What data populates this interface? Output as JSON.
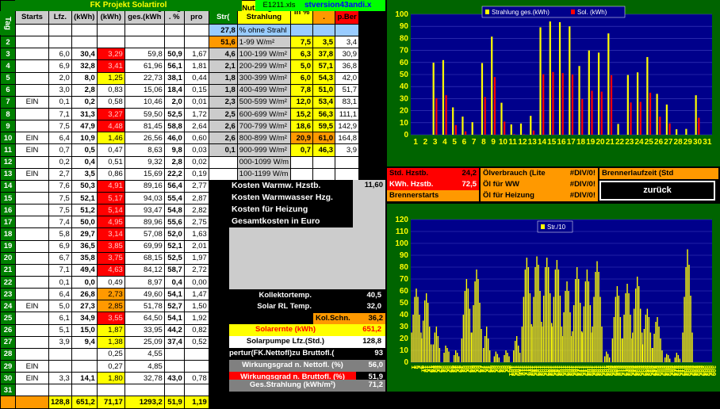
{
  "header": {
    "title": "FK Projekt Solartirol",
    "filename": "E1211.xls",
    "version": "stversion43andi.x",
    "tab": "Tag",
    "cols": [
      "Ofen Starts",
      "Sol.P Lfz.",
      "Sol. (kWh)",
      "Str/m² (kWh)",
      "Strahlung ges.(kWh",
      "Nzg . %",
      "kWh pro",
      "Ges Str(",
      "Nutzung der Strahlung",
      "in %",
      "Nutz .",
      "kWh p.Ber"
    ]
  },
  "rows": [
    {
      "i": "1",
      "o": "",
      "l": "",
      "s": "",
      "sm": "",
      "sg": "",
      "n": "",
      "k": "",
      "gs": "27,8",
      "nu": "% ohne Strahl",
      "ip": "",
      "nz": "",
      "kb": ""
    },
    {
      "i": "2",
      "o": "",
      "l": "",
      "s": "",
      "sm": "",
      "sg": "",
      "n": "",
      "k": "",
      "gs": "51,6",
      "nu": "1-99 W/m²",
      "ip": "7,5",
      "nz": "3,5",
      "kb": "3,4"
    },
    {
      "i": "3",
      "o": "",
      "l": "6,0",
      "s": "30,4",
      "sm": "3,29",
      "sg": "59,8",
      "n": "50,9",
      "k": "1,67",
      "gs": "4,6",
      "nu": "100-199 W/m²",
      "ip": "6,3",
      "nz": "37,8",
      "kb": "30,9"
    },
    {
      "i": "4",
      "o": "",
      "l": "6,9",
      "s": "32,8",
      "sm": "3,41",
      "sg": "61,96",
      "n": "56,1",
      "k": "1,81",
      "gs": "2,1",
      "nu": "200-299 W/m²",
      "ip": "5,0",
      "nz": "57,1",
      "kb": "36,8"
    },
    {
      "i": "5",
      "o": "",
      "l": "2,0",
      "s": "8,0",
      "sm": "1,25",
      "sg": "22,73",
      "n": "38,1",
      "k": "0,44",
      "gs": "1,8",
      "nu": "300-399 W/m²",
      "ip": "6,0",
      "nz": "54,3",
      "kb": "42,0"
    },
    {
      "i": "6",
      "o": "",
      "l": "3,0",
      "s": "2,8",
      "sm": "0,83",
      "sg": "15,06",
      "n": "18,4",
      "k": "0,15",
      "gs": "1,8",
      "nu": "400-499 W/m²",
      "ip": "7,8",
      "nz": "51,0",
      "kb": "51,7"
    },
    {
      "i": "7",
      "o": "EIN",
      "l": "0,1",
      "s": "0,2",
      "sm": "0,58",
      "sg": "10,46",
      "n": "2,0",
      "k": "0,01",
      "gs": "2,3",
      "nu": "500-599 W/m²",
      "ip": "12,0",
      "nz": "53,4",
      "kb": "83,1"
    },
    {
      "i": "8",
      "o": "",
      "l": "7,1",
      "s": "31,3",
      "sm": "3,27",
      "sg": "59,50",
      "n": "52,5",
      "k": "1,72",
      "gs": "2,5",
      "nu": "600-699 W/m²",
      "ip": "15,2",
      "nz": "56,3",
      "kb": "111,1"
    },
    {
      "i": "9",
      "o": "",
      "l": "7,5",
      "s": "47,9",
      "sm": "4,48",
      "sg": "81,45",
      "n": "58,8",
      "k": "2,64",
      "gs": "2,6",
      "nu": "700-799 W/m²",
      "ip": "18,6",
      "nz": "59,5",
      "kb": "142,9"
    },
    {
      "i": "10",
      "o": "EIN",
      "l": "6,4",
      "s": "10,9",
      "sm": "1,46",
      "sg": "26,56",
      "n": "46,0",
      "k": "0,60",
      "gs": "2,6",
      "nu": "800-899 W/m²",
      "ip": "20,9",
      "nz": "61,0",
      "kb": "164,8"
    },
    {
      "i": "11",
      "o": "EIN",
      "l": "0,7",
      "s": "0,5",
      "sm": "0,47",
      "sg": "8,63",
      "n": "9,8",
      "k": "0,03",
      "gs": "0,1",
      "nu": "900-999 W/m²",
      "ip": "0,7",
      "nz": "46,3",
      "kb": "3,9"
    },
    {
      "i": "12",
      "o": "",
      "l": "0,2",
      "s": "0,4",
      "sm": "0,51",
      "sg": "9,32",
      "n": "2,8",
      "k": "0,02",
      "gs": "",
      "nu": "000-1099 W/m",
      "ip": "",
      "nz": "",
      "kb": ""
    },
    {
      "i": "13",
      "o": "EIN",
      "l": "2,7",
      "s": "3,5",
      "sm": "0,86",
      "sg": "15,69",
      "n": "22,2",
      "k": "0,19",
      "gs": "",
      "nu": "100-1199 W/m",
      "ip": "",
      "nz": "",
      "kb": ""
    },
    {
      "i": "14",
      "o": "",
      "l": "7,6",
      "s": "50,3",
      "sm": "4,91",
      "sg": "89,16",
      "n": "56,4",
      "k": "2,77",
      "gs": "",
      "nu": "",
      "ip": "",
      "nz": "",
      "kb": ""
    },
    {
      "i": "15",
      "o": "",
      "l": "7,5",
      "s": "52,1",
      "sm": "5,17",
      "sg": "94,03",
      "n": "55,4",
      "k": "2,87",
      "gs": "",
      "nu": "",
      "ip": "",
      "nz": "",
      "kb": ""
    },
    {
      "i": "16",
      "o": "",
      "l": "7,5",
      "s": "51,2",
      "sm": "5,14",
      "sg": "93,47",
      "n": "54,8",
      "k": "2,82",
      "gs": "",
      "nu": "",
      "ip": "",
      "nz": "",
      "kb": ""
    },
    {
      "i": "17",
      "o": "",
      "l": "7,4",
      "s": "50,0",
      "sm": "4,95",
      "sg": "89,96",
      "n": "55,6",
      "k": "2,75",
      "gs": "",
      "nu": "",
      "ip": "",
      "nz": "",
      "kb": ""
    },
    {
      "i": "18",
      "o": "",
      "l": "5,8",
      "s": "29,7",
      "sm": "3,14",
      "sg": "57,08",
      "n": "52,0",
      "k": "1,63",
      "gs": "",
      "nu": "",
      "ip": "",
      "nz": "",
      "kb": ""
    },
    {
      "i": "19",
      "o": "",
      "l": "6,9",
      "s": "36,5",
      "sm": "3,85",
      "sg": "69,99",
      "n": "52,1",
      "k": "2,01",
      "gs": "",
      "nu": "",
      "ip": "",
      "nz": "",
      "kb": ""
    },
    {
      "i": "20",
      "o": "",
      "l": "6,7",
      "s": "35,8",
      "sm": "3,75",
      "sg": "68,15",
      "n": "52,5",
      "k": "1,97",
      "gs": "",
      "nu": "",
      "ip": "",
      "nz": "",
      "kb": ""
    },
    {
      "i": "21",
      "o": "",
      "l": "7,1",
      "s": "49,4",
      "sm": "4,63",
      "sg": "84,12",
      "n": "58,7",
      "k": "2,72",
      "gs": "",
      "nu": "",
      "ip": "",
      "nz": "",
      "kb": ""
    },
    {
      "i": "22",
      "o": "",
      "l": "0,1",
      "s": "0,0",
      "sm": "0,49",
      "sg": "8,97",
      "n": "0,4",
      "k": "0,00",
      "gs": "",
      "nu": "",
      "ip": "",
      "nz": "",
      "kb": ""
    },
    {
      "i": "23",
      "o": "",
      "l": "6,4",
      "s": "26,8",
      "sm": "2,73",
      "sg": "49,60",
      "n": "54,1",
      "k": "1,47",
      "gs": "",
      "nu": "",
      "ip": "",
      "nz": "",
      "kb": ""
    },
    {
      "i": "24",
      "o": "EIN",
      "l": "5,0",
      "s": "27,3",
      "sm": "2,85",
      "sg": "51,78",
      "n": "52,7",
      "k": "1,50",
      "gs": "",
      "nu": "",
      "ip": "",
      "nz": "",
      "kb": ""
    },
    {
      "i": "25",
      "o": "",
      "l": "6,1",
      "s": "34,9",
      "sm": "3,55",
      "sg": "64,50",
      "n": "54,1",
      "k": "1,92",
      "gs": "",
      "nu": "",
      "ip": "",
      "nz": "",
      "kb": ""
    },
    {
      "i": "26",
      "o": "",
      "l": "5,1",
      "s": "15,0",
      "sm": "1,87",
      "sg": "33,95",
      "n": "44,2",
      "k": "0,82",
      "gs": "",
      "nu": "",
      "ip": "",
      "nz": "",
      "kb": ""
    },
    {
      "i": "27",
      "o": "",
      "l": "3,9",
      "s": "9,4",
      "sm": "1,38",
      "sg": "25,09",
      "n": "37,4",
      "k": "0,52",
      "gs": "",
      "nu": "",
      "ip": "",
      "nz": "",
      "kb": ""
    },
    {
      "i": "28",
      "o": "",
      "l": "",
      "s": "",
      "sm": "0,25",
      "sg": "4,55",
      "n": "",
      "k": "",
      "gs": "",
      "nu": "",
      "ip": "",
      "nz": "",
      "kb": ""
    },
    {
      "i": "29",
      "o": "EIN",
      "l": "",
      "s": "",
      "sm": "0,27",
      "sg": "4,85",
      "n": "",
      "k": "",
      "gs": "",
      "nu": "",
      "ip": "",
      "nz": "",
      "kb": ""
    },
    {
      "i": "30",
      "o": "EIN",
      "l": "3,3",
      "s": "14,1",
      "sm": "1,80",
      "sg": "32,78",
      "n": "43,0",
      "k": "0,78",
      "gs": "",
      "nu": "",
      "ip": "",
      "nz": "",
      "kb": ""
    },
    {
      "i": "31",
      "o": "",
      "l": "",
      "s": "",
      "sm": "",
      "sg": "",
      "n": "",
      "k": "",
      "gs": "",
      "nu": "",
      "ip": "",
      "nz": "",
      "kb": ""
    }
  ],
  "totals": {
    "l": "128,8",
    "s": "651,2",
    "sm": "71,17",
    "sg": "1293,2",
    "n": "51,9",
    "k": "1,19"
  },
  "costs": {
    "warmw_hzstb": "Kosten Warmw. Hzstb.",
    "warmw_hzstb_val": "11,60",
    "warmwasser": "Kosten Warmwasser Hzg.",
    "heizung": "Kosten für Heizung",
    "gesamt": "Gesamtkosten in Euro"
  },
  "stats": {
    "kollektortemp": "Kollektortemp.",
    "kollektortemp_val": "40,5",
    "solar_rl": "Solar RL Temp.",
    "solar_rl_val": "32,0",
    "kol_schn": "Kol.Schn.",
    "kol_schn_val": "36,2",
    "solarernte": "Solarernte (kWh)",
    "solarernte_val": "651,2",
    "solarpumpe": "Solarpumpe Lfz.(Std.)",
    "solarpumpe_val": "128,8",
    "apertur": "pertur(FK.Nettofl)zu Bruttofl.(",
    "apertur_val": "93",
    "wirk_netto": "Wirkungsgrad n. Nettofl. (%)",
    "wirk_netto_val": "56,0",
    "wirk_brutto": "Wirkungsgrad n. Bruttofl. (%)",
    "wirk_brutto_val": "51,9",
    "ges_strahlung": "Ges.Strahlung (kWh/m²)",
    "ges_strahlung_val": "71,2"
  },
  "side": {
    "std_hzstb": "Std. Hzstb.",
    "std_hzstb_val": "24,2",
    "kwh_hzstb": "KWh. Hzstb.",
    "kwh_hzstb_val": "72,5",
    "brennerstarts": "Brennerstarts",
    "oelverbrauch": "Ölverbrauch (Lite",
    "oelverbrauch_val": "#DIV/0!",
    "oel_ww": "Öl für WW",
    "oel_ww_val": "#DIV/0!",
    "oel_heizung": "Öl für Heizung",
    "oel_heizung_val": "#DIV/0!",
    "brennerlaufzeit": "Brennerlaufzeit (Std",
    "back_button": "zurück"
  },
  "colors": {
    "green": "#008000",
    "yellow": "#ffff00",
    "red": "#ff0000",
    "orange": "#ff9900",
    "cyan": "#99ccff",
    "chart_bg": "#00008b",
    "chart_frame": "#006400"
  },
  "chart_data": [
    {
      "type": "bar",
      "legend": [
        "Strahlung ges.(kWh)",
        "Sol.  (kWh)"
      ],
      "legend_position": "top",
      "categories": [
        "1",
        "2",
        "3",
        "4",
        "5",
        "6",
        "7",
        "8",
        "9",
        "10",
        "11",
        "12",
        "13",
        "14",
        "15",
        "16",
        "17",
        "18",
        "19",
        "20",
        "21",
        "22",
        "23",
        "24",
        "25",
        "26",
        "27",
        "28",
        "29",
        "30",
        "31"
      ],
      "series": [
        {
          "name": "Strahlung ges.(kWh)",
          "color": "#ffff00",
          "values": [
            0,
            0,
            59.8,
            61.96,
            22.73,
            15.06,
            10.46,
            59.5,
            81.45,
            26.56,
            8.63,
            9.32,
            15.69,
            89.16,
            94.03,
            93.47,
            89.96,
            57.08,
            69.99,
            68.15,
            84.12,
            8.97,
            49.6,
            51.78,
            64.5,
            33.95,
            25.09,
            4.55,
            4.85,
            32.78,
            0
          ]
        },
        {
          "name": "Sol.  (kWh)",
          "color": "#ff0000",
          "values": [
            0,
            0,
            30.4,
            32.8,
            8.0,
            2.8,
            0.2,
            31.3,
            47.9,
            10.9,
            0.5,
            0.4,
            3.5,
            50.3,
            52.1,
            51.2,
            50.0,
            29.7,
            36.5,
            35.8,
            49.4,
            0.0,
            26.8,
            27.3,
            34.9,
            15.0,
            9.4,
            0,
            0,
            14.1,
            0
          ]
        }
      ],
      "ylim": [
        0,
        100
      ],
      "yticks": [
        0,
        10,
        20,
        30,
        40,
        50,
        60,
        70,
        80,
        90,
        100
      ],
      "grid": true
    },
    {
      "type": "bar",
      "legend": [
        "Str./10"
      ],
      "legend_position": "top",
      "xticks": [
        "1",
        "3",
        "5",
        "7",
        "9",
        "11",
        "13",
        "15",
        "17",
        "19",
        "21",
        "23",
        "25",
        "27",
        "29",
        "31",
        "33",
        "35",
        "37",
        "39",
        "41",
        "43",
        "45",
        "47",
        "49",
        "51",
        "53",
        "55",
        "57",
        "59",
        "61",
        "63",
        "65",
        "67",
        "69",
        "71",
        "73",
        "75",
        "77",
        "79",
        "81",
        "83",
        "85",
        "87",
        "89",
        "91",
        "93",
        "95",
        "97",
        "99",
        "101",
        "103",
        "105",
        "107",
        "109",
        "111",
        "113",
        "115",
        "117",
        "119",
        "121",
        "123",
        "125",
        "127",
        "129",
        "131",
        "133",
        "135",
        "137",
        "139",
        "141",
        "143",
        "145",
        "147",
        "149",
        "151",
        "153",
        "155",
        "157",
        "159",
        "161",
        "163",
        "165",
        "167",
        "169",
        "171",
        "173",
        "175",
        "177",
        "179",
        "181",
        "183",
        "185",
        "187",
        "189",
        "191",
        "193",
        "195",
        "197",
        "199",
        "201",
        "203",
        "205",
        "207",
        "209",
        "211",
        "213",
        "215",
        "217",
        "219",
        "221",
        "223",
        "225",
        "227",
        "229",
        "231",
        "233",
        "235",
        "237",
        "239",
        "241",
        "243",
        "245",
        "247",
        "249",
        "251",
        "253",
        "255",
        "257",
        "259",
        "261",
        "263",
        "265",
        "267",
        "269",
        "271",
        "273",
        "275",
        "277",
        "279",
        "281",
        "283",
        "285",
        "287",
        "289",
        "291",
        "293",
        "295",
        "297",
        "299",
        "301",
        "303",
        "305",
        "307",
        "309"
      ],
      "days": [
        {
          "d": 3,
          "v": [
            25,
            40,
            55,
            62,
            55,
            40,
            25
          ]
        },
        {
          "d": 4,
          "v": [
            20,
            35,
            52,
            58,
            50,
            30,
            15
          ]
        },
        {
          "d": 5,
          "v": [
            15,
            25,
            30,
            22,
            12
          ]
        },
        {
          "d": 6,
          "v": [
            8,
            14,
            12,
            9
          ]
        },
        {
          "d": 7,
          "v": [
            6,
            10,
            8,
            5
          ]
        },
        {
          "d": 8,
          "v": [
            20,
            40,
            60,
            70,
            62,
            45,
            25
          ]
        },
        {
          "d": 9,
          "v": [
            25,
            48,
            68,
            78,
            70,
            50,
            28
          ]
        },
        {
          "d": 10,
          "v": [
            12,
            22,
            30,
            20,
            10
          ]
        },
        {
          "d": 11,
          "v": [
            5,
            9,
            7,
            4
          ]
        },
        {
          "d": 12,
          "v": [
            6,
            10,
            8,
            5
          ]
        },
        {
          "d": 13,
          "v": [
            10,
            18,
            22,
            14,
            8
          ]
        },
        {
          "d": 14,
          "v": [
            30,
            55,
            78,
            88,
            80,
            58,
            32
          ]
        },
        {
          "d": 15,
          "v": [
            30,
            55,
            80,
            89,
            82,
            60,
            34
          ]
        },
        {
          "d": 16,
          "v": [
            30,
            56,
            80,
            88,
            80,
            58,
            33
          ]
        },
        {
          "d": 17,
          "v": [
            30,
            55,
            78,
            86,
            78,
            56,
            30
          ]
        },
        {
          "d": 18,
          "v": [
            22,
            42,
            60,
            68,
            60,
            42,
            22
          ]
        },
        {
          "d": 19,
          "v": [
            26,
            48,
            70,
            80,
            70,
            50,
            26
          ]
        },
        {
          "d": 20,
          "v": [
            25,
            47,
            68,
            78,
            68,
            48,
            25
          ]
        },
        {
          "d": 21,
          "v": [
            30,
            55,
            76,
            85,
            76,
            55,
            30
          ]
        },
        {
          "d": 22,
          "v": [
            5,
            9,
            7,
            4
          ]
        },
        {
          "d": 23,
          "v": [
            20,
            38,
            55,
            64,
            56,
            38,
            20
          ]
        },
        {
          "d": 24,
          "v": [
            20,
            40,
            58,
            66,
            58,
            40,
            20
          ]
        },
        {
          "d": 25,
          "v": [
            25,
            45,
            62,
            72,
            64,
            45,
            25
          ]
        },
        {
          "d": 26,
          "v": [
            15,
            28,
            40,
            45,
            38,
            25,
            12
          ]
        },
        {
          "d": 27,
          "v": [
            12,
            24,
            34,
            38,
            30,
            20,
            10
          ]
        },
        {
          "d": 28,
          "v": [
            4,
            7,
            6,
            3
          ]
        },
        {
          "d": 29,
          "v": [
            4,
            8,
            6,
            3
          ]
        },
        {
          "d": 30,
          "v": [
            25,
            55,
            80,
            95,
            82,
            56,
            25
          ]
        }
      ],
      "ylim": [
        0,
        120
      ],
      "yticks": [
        0,
        10,
        20,
        30,
        40,
        50,
        60,
        70,
        80,
        90,
        100,
        110,
        120
      ],
      "grid": true
    }
  ]
}
